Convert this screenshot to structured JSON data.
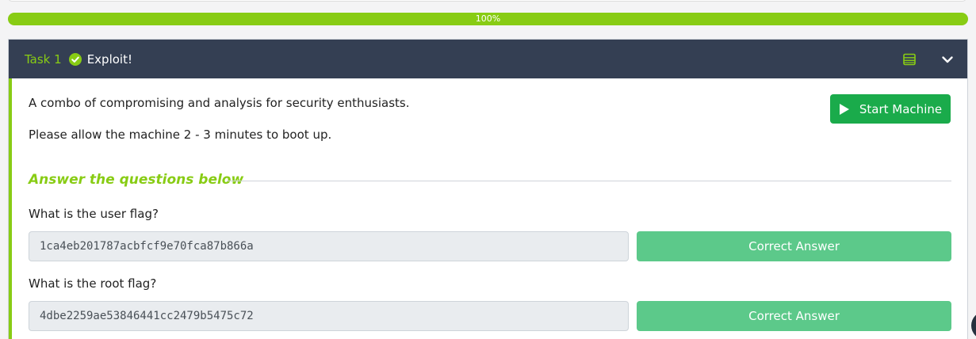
{
  "progress": {
    "label": "100%",
    "value_percent": 100
  },
  "task": {
    "number_label": "Task 1",
    "status_icon": "check-circle-icon",
    "title": "Exploit!",
    "description": "A combo of compromising and analysis for security enthusiasts.",
    "boot_note": "Please allow the machine 2 - 3 minutes to boot up.",
    "start_button_label": "Start Machine",
    "answers_heading": "Answer the questions below",
    "questions": [
      {
        "label": "What is the user flag?",
        "answer": "1ca4eb201787acbfcf9e70fca87b866a",
        "button_label": "Correct Answer"
      },
      {
        "label": "What is the root flag?",
        "answer": "4dbe2259ae53846441cc2479b5475c72",
        "button_label": "Correct Answer"
      }
    ]
  },
  "colors": {
    "accent_green": "#88cc14",
    "header_bg": "#343f53",
    "start_button_bg": "#1aab4b",
    "correct_button_bg": "#5cc98a"
  }
}
